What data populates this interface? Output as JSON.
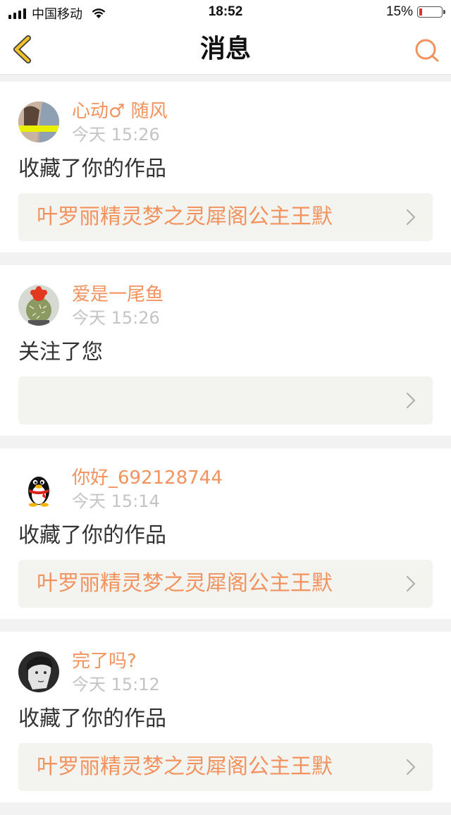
{
  "status_bar": {
    "carrier": "中国移动",
    "time": "18:52",
    "battery_percent": "15%",
    "battery_level": 0.15,
    "icons": [
      "signal-icon",
      "wifi-icon",
      "battery-icon"
    ]
  },
  "header": {
    "title": "消息",
    "back_icon": "back-chevron-icon",
    "search_icon": "search-icon"
  },
  "colors": {
    "accent": "#f2935f",
    "icon_yellow": "#f1c12b",
    "background": "#f2f2f2",
    "work_box": "#f3f3ef"
  },
  "messages": [
    {
      "username": "心动♂  随风",
      "time": "今天 15:26",
      "action": "收藏了你的作品",
      "work_title": "叶罗丽精灵梦之灵犀阁公主王默",
      "avatar": "photo-avatar"
    },
    {
      "username": "爱是一尾鱼",
      "time": "今天 15:26",
      "action": "关注了您",
      "work_title": "",
      "avatar": "cactus-avatar"
    },
    {
      "username": "你好_692128744",
      "time": "今天 15:14",
      "action": "收藏了你的作品",
      "work_title": "叶罗丽精灵梦之灵犀阁公主王默",
      "avatar": "penguin-avatar"
    },
    {
      "username": "完了吗?",
      "time": "今天 15:12",
      "action": "收藏了你的作品",
      "work_title": "叶罗丽精灵梦之灵犀阁公主王默",
      "avatar": "portrait-avatar"
    }
  ]
}
